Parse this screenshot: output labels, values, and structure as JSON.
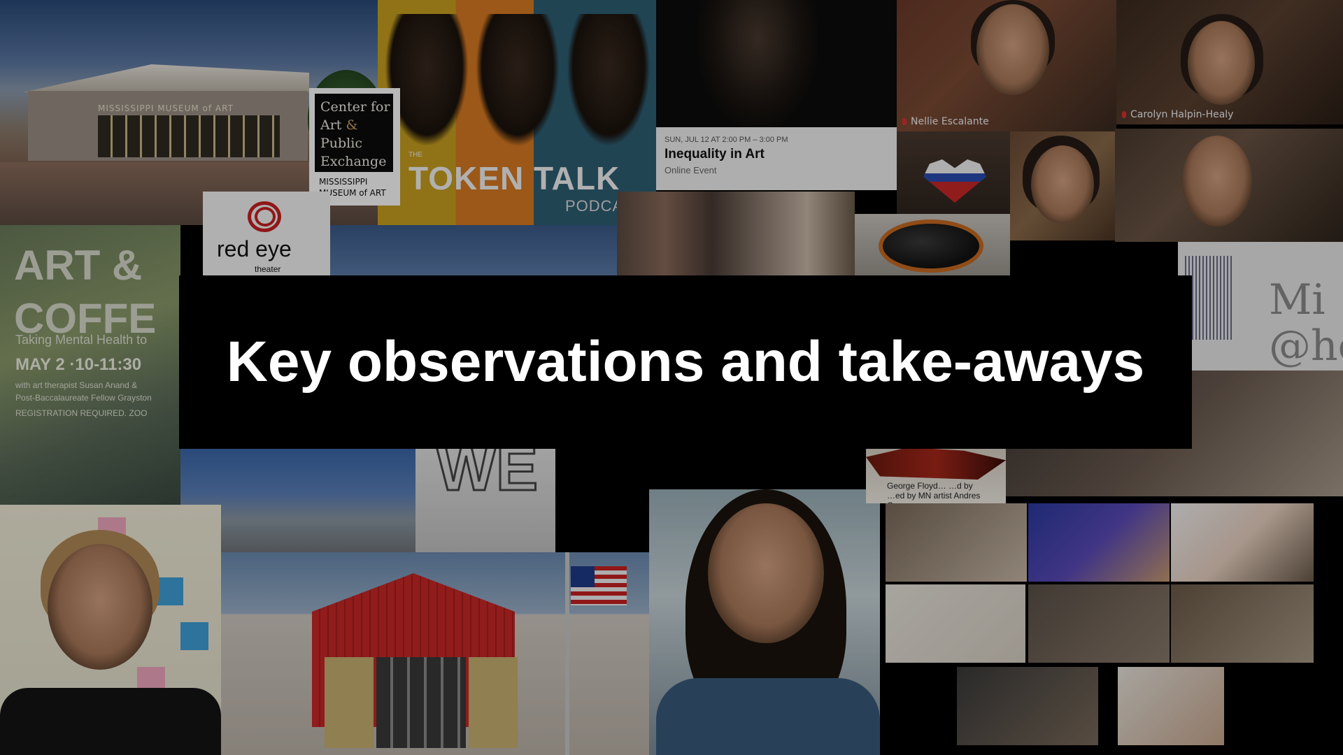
{
  "slide": {
    "title": "Key observations and take-aways"
  },
  "collage": {
    "museum_sign": "MISSISSIPPI MUSEUM of ART",
    "capex": {
      "line1": "Center for",
      "line2a": "Art ",
      "line2b": "&",
      "line3": "Public",
      "line4": "Exchange",
      "foot1": "MISSISSIPPI",
      "foot2": "MUSEUM of ART"
    },
    "token_talk": {
      "pre": "THE",
      "title": "TOKEN TALK",
      "sub": "PODCA"
    },
    "event_card": {
      "date": "SUN, JUL 12 AT 2:00 PM – 3:00 PM",
      "title": "Inequality in Art",
      "type": "Online Event"
    },
    "zoom_names": {
      "nellie": "Nellie Escalante",
      "carolyn": "Carolyn Halpin-Healy"
    },
    "red_eye": {
      "name": "red eye",
      "small": "theater"
    },
    "art_coffee": {
      "line1": "ART &",
      "line2": "COFFE",
      "sub": "Taking Mental Health to",
      "date": "MAY 2 ·10-11:30",
      "detail1": "with art therapist Susan Anand &",
      "detail2": "Post-Baccalaureate Fellow Grayston",
      "detail3": "REGISTRATION REQUIRED. ZOO"
    },
    "mind_tile": {
      "line1": "Mi",
      "line2": "@ho"
    },
    "we_letters": "WE",
    "wood_caption": "…ed by MN artist Andres Guzman.",
    "wood_caption_top": "George Floyd… …d by"
  }
}
